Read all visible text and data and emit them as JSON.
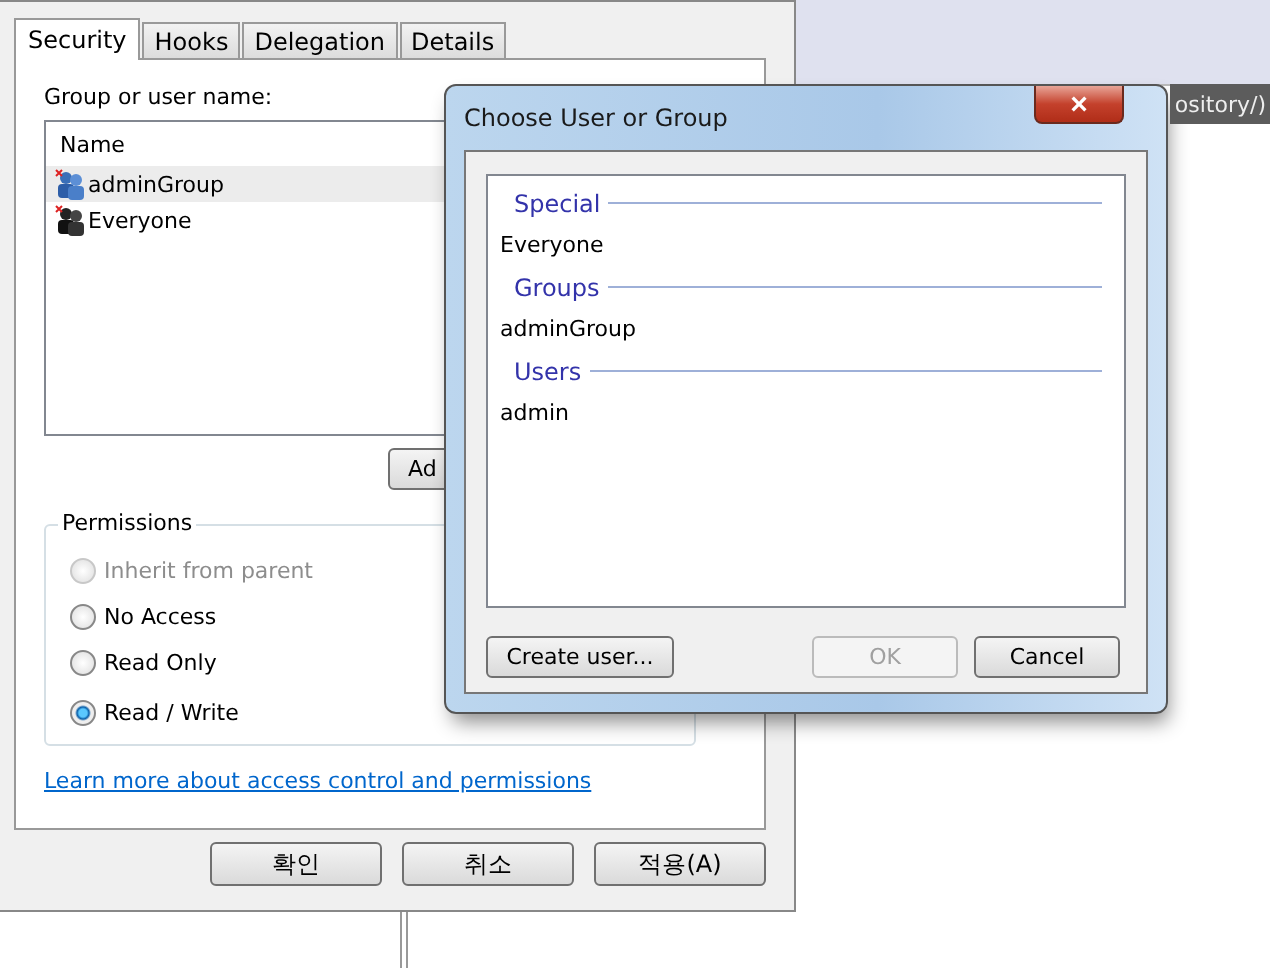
{
  "background_window": {
    "title_fragment": "ository/)"
  },
  "properties": {
    "tabs": [
      {
        "label": "Security",
        "selected": true
      },
      {
        "label": "Hooks",
        "selected": false
      },
      {
        "label": "Delegation",
        "selected": false
      },
      {
        "label": "Details",
        "selected": false
      }
    ],
    "group_label": "Group or user name:",
    "list": {
      "column": "Name",
      "rows": [
        {
          "name": "adminGroup",
          "kind": "group",
          "selected": true
        },
        {
          "name": "Everyone",
          "kind": "everyone",
          "selected": false
        }
      ]
    },
    "add_button": "Ad",
    "permissions": {
      "title": "Permissions",
      "options": [
        {
          "label": "Inherit from parent",
          "selected": false,
          "disabled": true
        },
        {
          "label": "No Access",
          "selected": false,
          "disabled": false
        },
        {
          "label": "Read Only",
          "selected": false,
          "disabled": false
        },
        {
          "label": "Read / Write",
          "selected": true,
          "disabled": false
        }
      ]
    },
    "link": "Learn more about access control and permissions",
    "buttons": [
      "확인",
      "취소",
      "적용(A)"
    ]
  },
  "dialog": {
    "title": "Choose User or Group",
    "close": "×",
    "sections": [
      {
        "heading": "Special",
        "items": [
          "Everyone"
        ]
      },
      {
        "heading": "Groups",
        "items": [
          "adminGroup"
        ]
      },
      {
        "heading": "Users",
        "items": [
          "admin"
        ]
      }
    ],
    "buttons": [
      {
        "label": "Create user...",
        "disabled": false
      },
      {
        "label": "OK",
        "disabled": true
      },
      {
        "label": "Cancel",
        "disabled": false
      }
    ]
  }
}
